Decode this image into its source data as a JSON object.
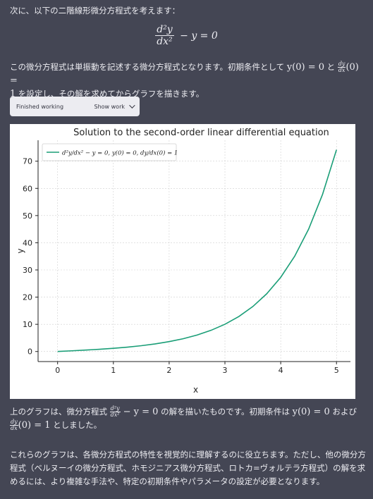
{
  "messages": {
    "intro": "次に、以下の二階線形微分方程式を考えます：",
    "equation": {
      "numerator": "d²y",
      "denominator": "dx²",
      "rest": "− y = 0"
    },
    "desc_part1": "この微分方程式は単振動を記述する微分方程式となります。初期条件として ",
    "desc_cond1": "y(0) = 0",
    "desc_part2": " と ",
    "desc_dnum": "dy",
    "desc_dden": "dx",
    "desc_cond2": "(0) =",
    "desc_part3": "1",
    "desc_part4": " を設定し、その解を求めてからグラフを描きます。",
    "after_part1": "上のグラフは、微分方程式 ",
    "after_num": "d²y",
    "after_den": "dx²",
    "after_eq": " − y = 0",
    "after_part2": " の解を描いたものです。初期条件は ",
    "after_cond1": "y(0) = 0",
    "after_part3": " および",
    "after_dnum": "dy",
    "after_dden": "dx",
    "after_cond2": "(0) = 1",
    "after_part4": " としました。",
    "closing": "これらのグラフは、各微分方程式の特性を視覚的に理解するのに役立ちます。ただし、他の微分方程式（ベルヌーイの微分方程式、ホモジニアス微分方程式、ロトカ=ヴォルテラ方程式）の解を求めるには、より複雑な手法や、特定の初期条件やパラメータの設定が必要となります。"
  },
  "work_button": {
    "status": "Finished working",
    "show": "Show work"
  },
  "chart_data": {
    "type": "line",
    "title": "Solution to the second-order linear differential equation",
    "xlabel": "x",
    "ylabel": "y",
    "xlim": [
      -0.35,
      5.25
    ],
    "ylim": [
      -3.7,
      77.7
    ],
    "xticks": [
      0,
      1,
      2,
      3,
      4,
      5
    ],
    "yticks": [
      0,
      10,
      20,
      30,
      40,
      50,
      60,
      70
    ],
    "grid": true,
    "legend_placement": "top-left",
    "series": [
      {
        "name": "d²y/dx² − y = 0, y(0) = 0, dy/dx(0) = 1",
        "color": "#1a9e77",
        "x": [
          0,
          0.25,
          0.5,
          0.75,
          1,
          1.25,
          1.5,
          1.75,
          2,
          2.25,
          2.5,
          2.75,
          3,
          3.25,
          3.5,
          3.75,
          4,
          4.25,
          4.5,
          4.75,
          5
        ],
        "y": [
          0,
          0.25,
          0.52,
          0.82,
          1.18,
          1.6,
          2.13,
          2.79,
          3.63,
          4.69,
          6.05,
          7.79,
          10.02,
          12.88,
          16.54,
          21.25,
          27.29,
          35.04,
          45.0,
          57.79,
          74.2
        ]
      }
    ]
  }
}
